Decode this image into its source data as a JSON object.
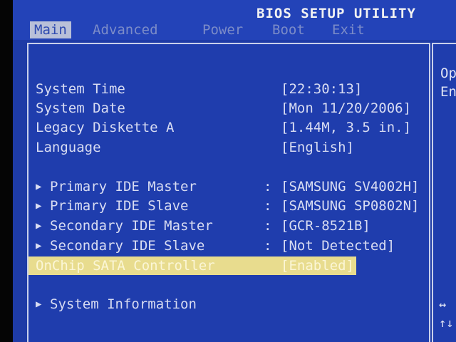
{
  "window": {
    "title": "BIOS SETUP UTILITY"
  },
  "menu": {
    "tabs": [
      {
        "label": "Main",
        "active": true
      },
      {
        "label": "Advanced",
        "active": false
      },
      {
        "label": "Power",
        "active": false
      },
      {
        "label": "Boot",
        "active": false
      },
      {
        "label": "Exit",
        "active": false
      }
    ]
  },
  "main": {
    "system_time": {
      "label": "System Time",
      "value": "[22:30:13]"
    },
    "system_date": {
      "label": "System Date",
      "value": "[Mon 11/20/2006]"
    },
    "legacy_diskette": {
      "label": "Legacy Diskette A",
      "value": "[1.44M, 3.5 in.]"
    },
    "language": {
      "label": "Language",
      "value": "[English]"
    },
    "ide_devices": [
      {
        "label": "Primary IDE Master",
        "sep": ":",
        "value": "[SAMSUNG SV4002H]"
      },
      {
        "label": "Primary IDE Slave",
        "sep": ":",
        "value": "[SAMSUNG SP0802N]"
      },
      {
        "label": "Secondary IDE Master",
        "sep": ":",
        "value": "[GCR-8521B]"
      },
      {
        "label": "Secondary IDE Slave",
        "sep": ":",
        "value": "[Not Detected]"
      }
    ],
    "onchip_sata": {
      "label": "OnChip SATA Controller",
      "value": "[Enabled]"
    },
    "system_information": {
      "label": "System Information"
    }
  },
  "side": {
    "line1": "Op",
    "line2": "En",
    "nav_select": "↔",
    "nav_move": "↑↓"
  },
  "colors": {
    "background": "#1e3ba6",
    "highlight": "#e8dc8e",
    "text": "#d8dcf2"
  }
}
